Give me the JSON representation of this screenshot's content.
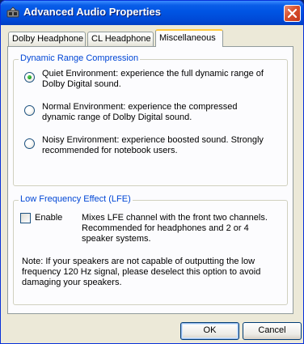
{
  "window": {
    "title": "Advanced Audio Properties",
    "close_glyph": "close-icon"
  },
  "tabs": [
    {
      "label": "Dolby Headphone",
      "active": false
    },
    {
      "label": "CL Headphone",
      "active": false
    },
    {
      "label": "Miscellaneous",
      "active": true
    }
  ],
  "drc": {
    "caption": "Dynamic Range Compression",
    "options": [
      {
        "label": "Quiet Environment: experience the full dynamic range of Dolby Digital sound.",
        "selected": true
      },
      {
        "label": "Normal Environment: experience the compressed dynamic range of Dolby Digital sound.",
        "selected": false
      },
      {
        "label": "Noisy Environment: experience boosted sound. Strongly recommended for notebook users.",
        "selected": false
      }
    ]
  },
  "lfe": {
    "caption": "Low Frequency Effect (LFE)",
    "enable_label": "Enable",
    "enabled": false,
    "description": "Mixes LFE channel with the front two channels. Recommended for headphones and 2 or 4 speaker systems.",
    "note": "Note: If your speakers are not capable of outputting the low frequency 120 Hz signal, please deselect this option to avoid damaging your speakers."
  },
  "buttons": {
    "ok": "OK",
    "cancel": "Cancel"
  },
  "colors": {
    "titlebar": "#0054e3",
    "group_caption": "#0046d5",
    "close_button": "#d8502c",
    "radio_selected": "#21a121",
    "active_tab_accent": "#ffc83c"
  }
}
